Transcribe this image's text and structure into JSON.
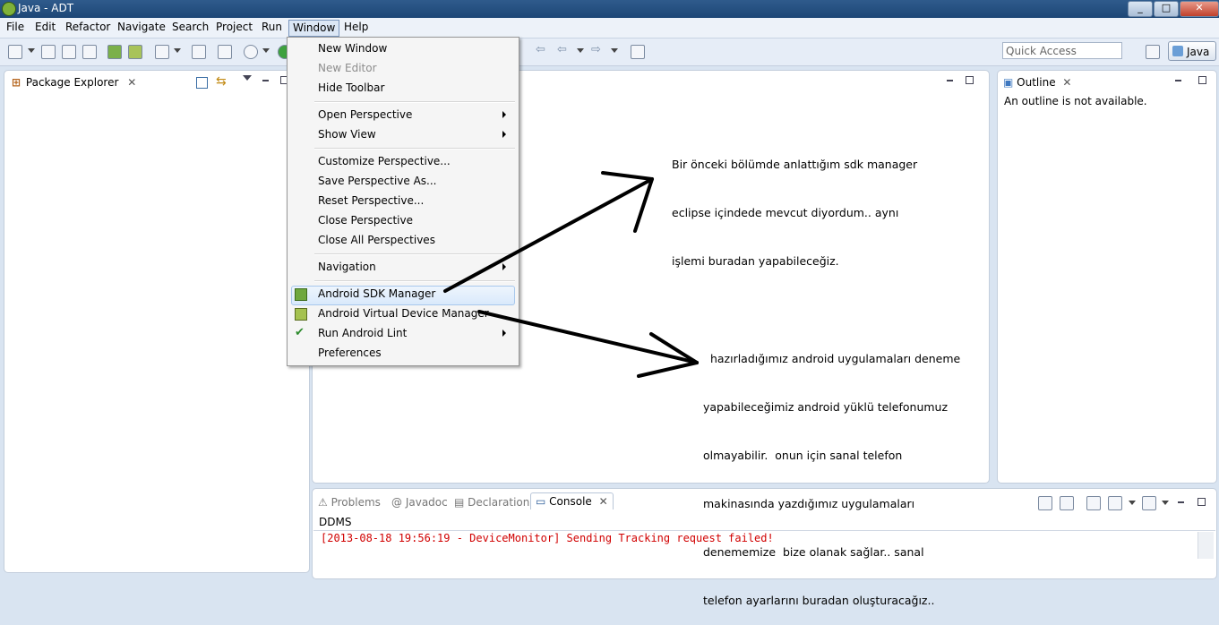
{
  "window": {
    "title": "Java - ADT",
    "min": "_",
    "max": "□",
    "close": "✕"
  },
  "menubar": [
    "File",
    "Edit",
    "Refactor",
    "Navigate",
    "Search",
    "Project",
    "Run",
    "Window",
    "Help"
  ],
  "toolbar": {
    "quick_access_placeholder": "Quick Access",
    "perspective": "Java"
  },
  "window_menu": {
    "items": {
      "new_window": "New Window",
      "new_editor": "New Editor",
      "hide_toolbar": "Hide Toolbar",
      "open_perspective": "Open Perspective",
      "show_view": "Show View",
      "customize_perspective": "Customize Perspective...",
      "save_perspective_as": "Save Perspective As...",
      "reset_perspective": "Reset Perspective...",
      "close_perspective": "Close Perspective",
      "close_all_perspectives": "Close All Perspectives",
      "navigation": "Navigation",
      "android_sdk_manager": "Android SDK Manager",
      "android_avd_manager": "Android Virtual Device Manager",
      "run_android_lint": "Run Android Lint",
      "preferences": "Preferences"
    }
  },
  "package_explorer": {
    "tab": "Package Explorer"
  },
  "outline": {
    "tab": "Outline",
    "message": "An outline is not available."
  },
  "bottom_panel": {
    "tabs": {
      "problems": "Problems",
      "javadoc": "Javadoc",
      "declaration": "Declaration",
      "console": "Console"
    },
    "console_name": "DDMS",
    "console_line": "[2013-08-18 19:56:19 - DeviceMonitor] Sending Tracking request failed!"
  },
  "annotations": {
    "note1": {
      "line1": "Bir önceki bölümde anlattığım sdk manager",
      "line2": "eclipse içindede mevcut diyordum.. aynı",
      "line3": "işlemi buradan yapabileceğiz."
    },
    "note2": {
      "line1": "  hazırladığımız android uygulamaları deneme",
      "line2": "yapabileceğimiz android yüklü telefonumuz",
      "line3": "olmayabilir.  onun için sanal telefon",
      "line4": "makinasında yazdığımız uygulamaları",
      "line5": "denememize  bize olanak sağlar.. sanal",
      "line6": "telefon ayarlarını buradan oluşturacağız.."
    }
  },
  "colors": {
    "accent": "#2f5b8c",
    "console_error": "#d10000",
    "highlight": "#d9e9fb"
  }
}
